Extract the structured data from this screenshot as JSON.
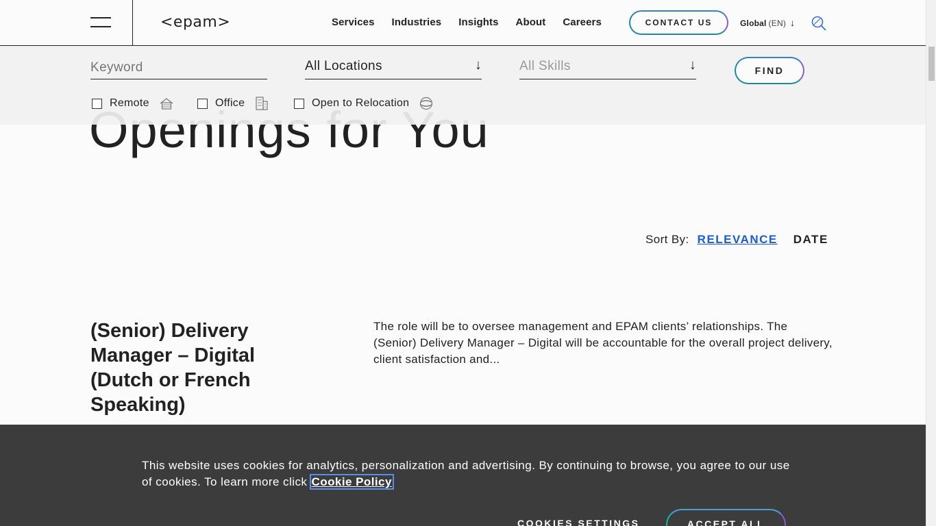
{
  "header": {
    "logo": "<epam>",
    "nav": [
      "Services",
      "Industries",
      "Insights",
      "About",
      "Careers"
    ],
    "contact_label": "CONTACT US",
    "global_label": "Global",
    "global_lang": "(EN)",
    "global_arrow": "↓"
  },
  "filters": {
    "keyword_placeholder": "Keyword",
    "location_value": "All Locations",
    "skills_placeholder": "All Skills",
    "arrow": "↓",
    "find_label": "FIND",
    "checkboxes": [
      {
        "label": "Remote",
        "checked": false,
        "icon": "house-icon"
      },
      {
        "label": "Office",
        "checked": false,
        "icon": "office-building-icon"
      },
      {
        "label": "Open to Relocation",
        "checked": false,
        "icon": "globe-icon"
      }
    ]
  },
  "main": {
    "headline": "Openings for You",
    "sort_label": "Sort By:",
    "sort_relevance": "RELEVANCE",
    "sort_date": "DATE"
  },
  "job": {
    "title": "(Senior) Delivery Manager – Digital (Dutch or French Speaking)",
    "description": "The role will be to oversee management and EPAM clients’ relationships. The (Senior) Delivery Manager – Digital will be accountable for the overall project delivery, client satisfaction and..."
  },
  "cookie": {
    "text": "This website uses cookies for analytics, personalization and advertising. By continuing to browse, you agree to our use of cookies. To learn more click ",
    "link": "Cookie Policy",
    "settings_label": "COOKIES SETTINGS",
    "accept_label": "ACCEPT ALL"
  },
  "colors": {
    "accent_blue": "#1b5bd3",
    "gradient_teal": "#1a8aa8",
    "gradient_purple": "#8a5bd1",
    "cookie_bg": "#343434"
  }
}
